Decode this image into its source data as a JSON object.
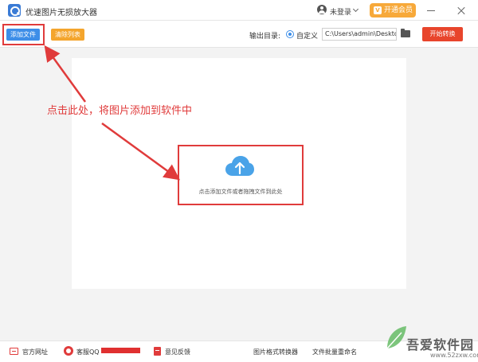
{
  "app": {
    "title": "优速图片无损放大器"
  },
  "titlebar": {
    "login_label": "未登录",
    "vip_label": "开通会员",
    "vip_icon": "V"
  },
  "toolbar": {
    "add_file_label": "添加文件",
    "clear_list_label": "清除列表",
    "output_dir_label": "输出目录:",
    "custom_label": "自定义",
    "output_path_value": "C:\\Users\\admin\\Deskto",
    "start_convert_label": "开始转换"
  },
  "main": {
    "drop_hint": "点击添加文件或者拖拽文件到此处",
    "annotation": "点击此处，将图片添加到软件中"
  },
  "footer": {
    "website_label": "官方网址",
    "qq_label": "客服QQ",
    "feedback_label": "意见反馈",
    "format_convert_label": "图片格式转换器",
    "batch_rename_label": "文件批量重命名"
  },
  "watermark": {
    "brand": "吾爱软件园",
    "url": "www.52zxw.com"
  },
  "colors": {
    "primary_blue": "#3d8ee8",
    "orange": "#f4a52d",
    "vip_orange": "#f7a93a",
    "start_red": "#e8452c",
    "annotation_red": "#e03b3b",
    "cloud_blue": "#4aa3e8"
  },
  "icons": {
    "app_logo": "magnifier-image-icon",
    "user": "user-icon",
    "folder": "folder-icon",
    "upload": "upload-cloud-icon",
    "website": "website-icon",
    "qq": "qq-icon",
    "feedback": "feedback-icon"
  }
}
